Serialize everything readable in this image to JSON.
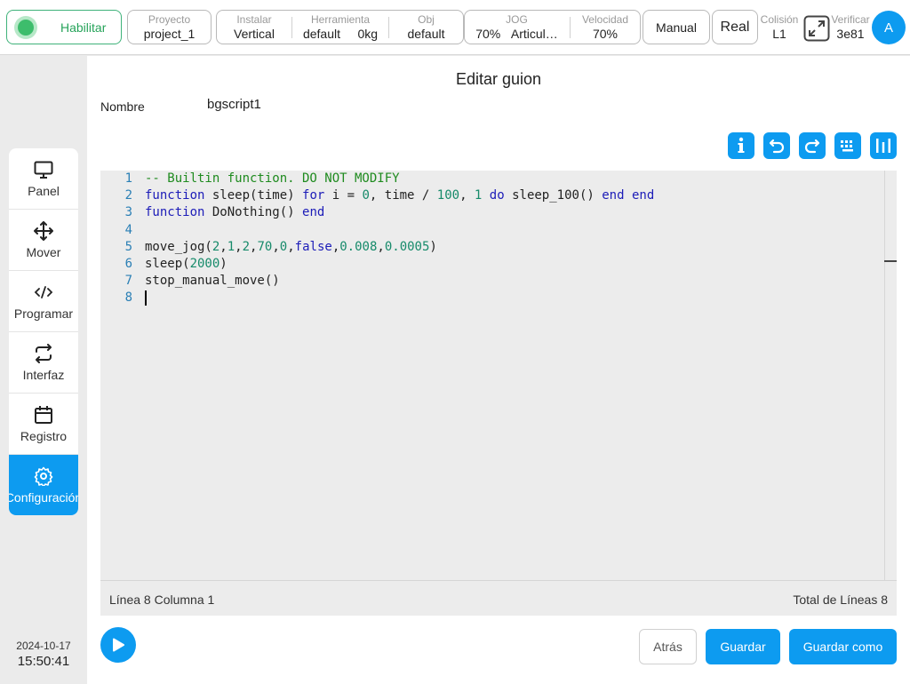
{
  "topbar": {
    "enable_label": "Habilitar",
    "project": {
      "caption": "Proyecto",
      "value": "project_1"
    },
    "install": {
      "caption": "Instalar",
      "value": "Vertical"
    },
    "tool": {
      "caption": "Herramienta",
      "value": "default",
      "payload": "0kg"
    },
    "obj": {
      "caption": "Obj",
      "value": "default"
    },
    "jog": {
      "caption": "JOG",
      "percent": "70%",
      "mode": "Articul…"
    },
    "speed": {
      "caption": "Velocidad",
      "value": "70%"
    },
    "manual_label": "Manual",
    "real_label": "Real",
    "collision": {
      "caption": "Colisión",
      "value": "L1"
    },
    "verify": {
      "caption": "Verificar",
      "value": "3e81"
    },
    "avatar_letter": "A"
  },
  "sidebar": {
    "items": [
      {
        "label": "Panel",
        "icon": "monitor-icon"
      },
      {
        "label": "Mover",
        "icon": "move-arrows-icon"
      },
      {
        "label": "Programar",
        "icon": "code-icon"
      },
      {
        "label": "Interfaz",
        "icon": "swap-arrows-icon"
      },
      {
        "label": "Registro",
        "icon": "calendar-icon"
      },
      {
        "label": "Configuración",
        "icon": "gear-icon",
        "active": true
      }
    ]
  },
  "datetime": {
    "date": "2024-10-17",
    "time": "15:50:41"
  },
  "editor": {
    "title": "Editar guion",
    "name_label": "Nombre",
    "name_value": "bgscript1",
    "lines": [
      "-- Builtin function. DO NOT MODIFY",
      "function sleep(time) for i = 0, time / 100, 1 do sleep_100() end end",
      "function DoNothing() end",
      "",
      "move_jog(2,1,2,70,0,false,0.008,0.0005)",
      "sleep(2000)",
      "stop_manual_move()",
      ""
    ],
    "status_left": "Línea 8 Columna 1",
    "status_right": "Total de Líneas 8"
  },
  "actions": {
    "back": "Atrás",
    "save": "Guardar",
    "save_as": "Guardar como"
  },
  "colors": {
    "accent": "#0d9bf0",
    "enabled_green": "#3dbd6c"
  }
}
